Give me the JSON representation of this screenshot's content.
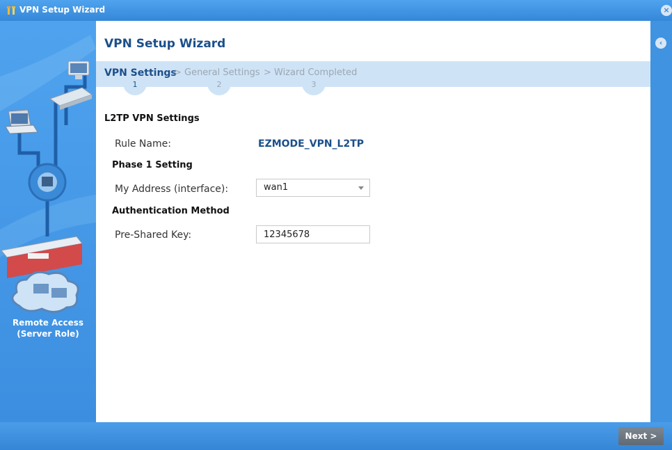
{
  "window": {
    "title": "VPN Setup Wizard",
    "close_glyph": "×",
    "back_glyph": "‹"
  },
  "sidebar": {
    "role_label_line1": "Remote Access",
    "role_label_line2": "(Server Role)"
  },
  "wizard": {
    "title": "VPN Setup Wizard",
    "steps": [
      {
        "label": "VPN Settings",
        "number": "1",
        "active": true
      },
      {
        "label": "General Settings",
        "number": "2",
        "active": false
      },
      {
        "label": "Wizard Completed",
        "number": "3",
        "active": false
      }
    ],
    "separator": ">"
  },
  "form": {
    "section_title": "L2TP VPN Settings",
    "rule_name_label": "Rule Name:",
    "rule_name_value": "EZMODE_VPN_L2TP",
    "phase1_title": "Phase 1 Setting",
    "my_address_label": "My Address (interface):",
    "my_address_value": "wan1",
    "auth_title": "Authentication Method",
    "psk_label": "Pre-Shared Key:",
    "psk_value": "12345678"
  },
  "footer": {
    "next_label": "Next >"
  },
  "colors": {
    "accent": "#3f93e1",
    "title_text": "#1c4f8a",
    "steps_bar": "#cfe3f6"
  }
}
